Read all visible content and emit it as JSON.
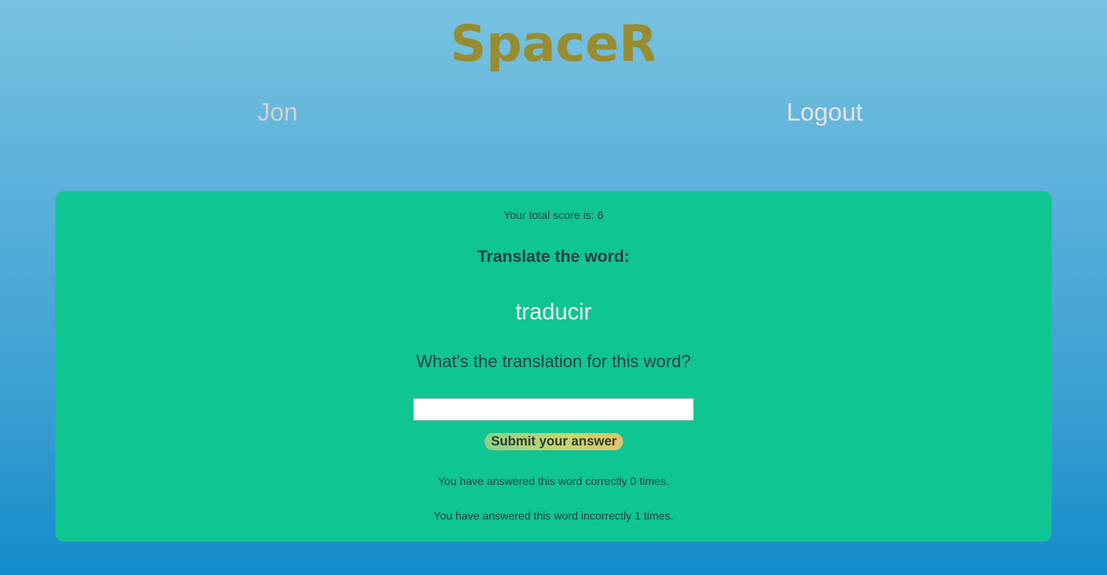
{
  "app": {
    "logo_text": "SpaceR",
    "logo_color": "#988c30"
  },
  "nav": {
    "user_name": "Jon",
    "logout_label": "Logout"
  },
  "card": {
    "score_text": "Your total score is: 6",
    "heading": "Translate the word:",
    "word": "traducir",
    "question": "What's the translation for this word?",
    "answer_value": "",
    "submit_label": "Submit your answer",
    "correct_text": "You have answered this word correctly 0 times.",
    "incorrect_text": "You have answered this word incorrectly 1 times."
  },
  "colors": {
    "card_background": "#0fc592",
    "text_dark": "#2e3f46",
    "word_text": "#eaf7ef"
  }
}
